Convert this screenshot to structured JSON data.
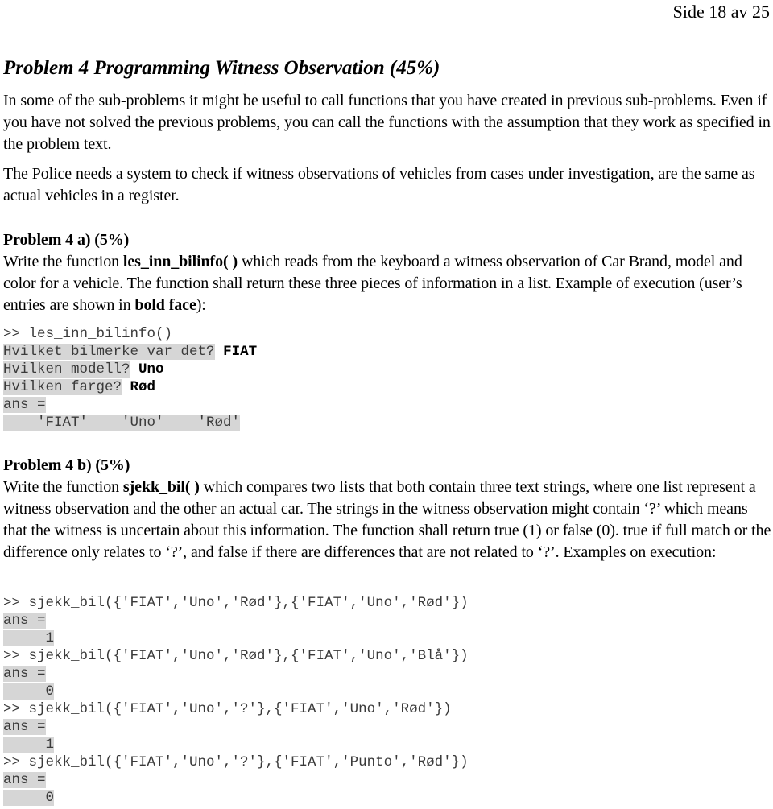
{
  "header": {
    "page_indicator": "Side 18 av 25"
  },
  "problem": {
    "title": "Problem 4 Programming Witness Observation (45%)",
    "intro": "In some of the sub-problems it might be useful to call functions that you have created in previous sub-problems. Even if you have not solved the previous problems, you can call the functions with the assumption that they work as specified in the problem text.",
    "context": "The Police needs a system to check if witness observations of vehicles from cases under investigation, are the same as actual vehicles in a register."
  },
  "part_a": {
    "heading": "Problem 4 a) (5%)",
    "text_1": "Write the function ",
    "function_name": "les_inn_bilinfo( )",
    "text_2": " which reads from the keyboard a witness observation of Car Brand, model and color for a vehicle. The function shall return these three pieces of information in a list. Example of execution (user’s entries are shown in ",
    "bold_term": "bold face",
    "text_3": "):",
    "example": {
      "command": ">> les_inn_bilinfo()",
      "prompts": [
        {
          "prompt": "Hvilket bilmerke var det?",
          "input": "FIAT"
        },
        {
          "prompt": "Hvilken modell?",
          "input": "Uno"
        },
        {
          "prompt": "Hvilken farge?",
          "input": "Rød"
        }
      ],
      "ans_label": "ans =",
      "result": "    'FIAT'    'Uno'    'Rød'"
    }
  },
  "part_b": {
    "heading": "Problem 4 b) (5%)",
    "text_1": "Write the function ",
    "function_name": "sjekk_bil( )",
    "text_2": " which compares two lists that both contain three text strings, where one list represent a witness observation and the other an actual car. The strings in the witness observation might contain ‘?’ which means that the witness is uncertain about this information. The function shall return true (1) or false (0). true if full match or the difference only relates to ‘?’, and false if there are differences that are not related to ‘?’. Examples on execution:",
    "examples": [
      {
        "command": ">> sjekk_bil({'FIAT','Uno','Rød'},{'FIAT','Uno','Rød'})",
        "ans_label": "ans =",
        "result": "     1"
      },
      {
        "command": ">> sjekk_bil({'FIAT','Uno','Rød'},{'FIAT','Uno','Blå'})",
        "ans_label": "ans =",
        "result": "     0"
      },
      {
        "command": ">> sjekk_bil({'FIAT','Uno','?'},{'FIAT','Uno','Rød'})",
        "ans_label": "ans =",
        "result": "     1"
      },
      {
        "command": ">> sjekk_bil({'FIAT','Uno','?'},{'FIAT','Punto','Rød'})",
        "ans_label": "ans =",
        "result": "     0"
      }
    ]
  }
}
